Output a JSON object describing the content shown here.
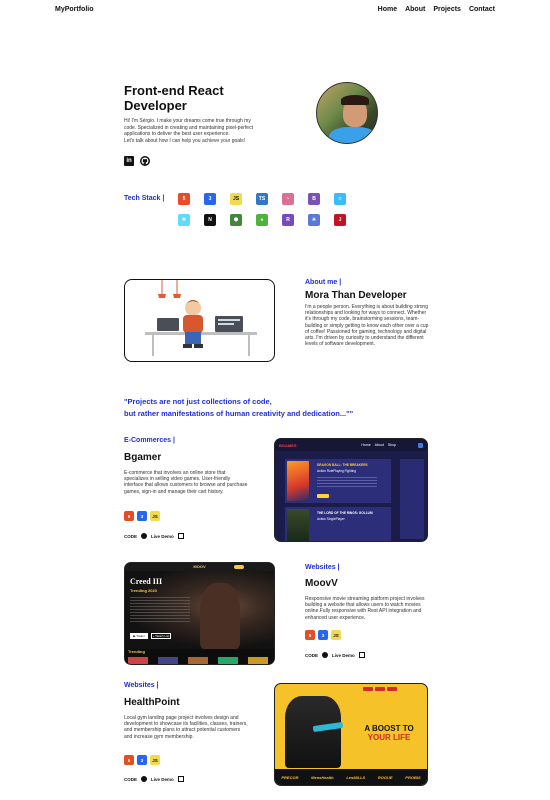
{
  "nav": {
    "logo": "MyPortfolio",
    "links": [
      "Home",
      "About",
      "Projects",
      "Contact"
    ]
  },
  "hero": {
    "title_line1": "Front-end React",
    "title_line2": "Developer",
    "text_line1": "Hi! I'm Sérgio. I make your dreams come true through my",
    "text_line2": "code. Specialized in creating and maintaining pixel-perfect",
    "text_line3": "applications to deliver the best user experience.",
    "text_line4": "Let's talk about how I can help you achieve your goals!",
    "social": {
      "linkedin_icon": "linkedin-icon",
      "github_icon": "github-icon"
    }
  },
  "tech_stack": {
    "label": "Tech Stack |",
    "icons": [
      {
        "name": "html5-icon",
        "glyph": "5",
        "color": "#e44d26"
      },
      {
        "name": "css3-icon",
        "glyph": "3",
        "color": "#2965f1"
      },
      {
        "name": "javascript-icon",
        "glyph": "JS",
        "color": "#f0db4f"
      },
      {
        "name": "typescript-icon",
        "glyph": "TS",
        "color": "#3178c6"
      },
      {
        "name": "styled-components-icon",
        "glyph": "~",
        "color": "#db7093"
      },
      {
        "name": "bootstrap-icon",
        "glyph": "B",
        "color": "#7952b3"
      },
      {
        "name": "tailwind-icon",
        "glyph": "≈",
        "color": "#38bdf8"
      },
      {
        "name": "react-icon",
        "glyph": "⚛",
        "color": "#61dafb"
      },
      {
        "name": "nextjs-icon",
        "glyph": "N",
        "color": "#111111"
      },
      {
        "name": "nodejs-icon",
        "glyph": "⬢",
        "color": "#43853d"
      },
      {
        "name": "mongodb-icon",
        "glyph": "♠",
        "color": "#4db33d"
      },
      {
        "name": "redux-icon",
        "glyph": "R",
        "color": "#764abc"
      },
      {
        "name": "testing-library-icon",
        "glyph": "☀",
        "color": "#5a7ad6"
      },
      {
        "name": "jest-icon",
        "glyph": "J",
        "color": "#c21325"
      }
    ]
  },
  "about": {
    "label": "About me |",
    "title": "Mora Than Developer",
    "text": "I'm a people person. Everything is about building strong relationships and looking for ways to connect. Whether it's through my code, brainstorming sessions, team-building or simply getting to know each other over a cup of coffee! Passioned for gaming, technology and digital arts. I'm driven by curiosity to understand the different levels of software development."
  },
  "quote": {
    "line1": "\"Projects are not just collections of code,",
    "line2": "but rather manifestations of human creativity and dedication...\"\""
  },
  "projects": [
    {
      "category": "E-Commerces |",
      "title": "Bgamer",
      "desc": "E-commerce that involves an online store that specializes in selling video games. User-friendly interface that allows customers to browse and purchase games, sign-in and manage their cart history.",
      "code_label": "CODE",
      "demo_label": "Live Demo",
      "screenshot": {
        "logo": "BGAMES",
        "nav": [
          "Home",
          "About",
          "Shop"
        ],
        "game1": "DRAGON BALL: THE BREAKERS",
        "game1_sub": "Action RolePlaying Fighting",
        "game2": "THE LORD OF THE RINGS: GOLLUM",
        "game2_sub": "Action SinglePlayer",
        "cover1": "DRAGON BALL",
        "cover2": "GOLLUM"
      }
    },
    {
      "category": "Websites |",
      "title": "MoovV",
      "desc": "Responsive movie streaming platform project involves building a website that allows users to watch movies online.Fully responsive with Rest API integration and enhanced user experience.",
      "code_label": "CODE",
      "demo_label": "Live Demo",
      "screenshot": {
        "logo": "MOOV",
        "movie": "Creed III",
        "trending_label": "Trending 2023",
        "trailer_label": "▶ Trailer",
        "watchlist_label": "+ Watch List",
        "row_label": "Trending"
      }
    },
    {
      "category": "Websites |",
      "title": "HealthPoint",
      "desc": "Local gym landing page project involves design and development to showcase its facilities, classes, trainers, and membership plans to attract potential customers and increase gym membership.",
      "code_label": "CODE",
      "demo_label": "Live Demo",
      "screenshot": {
        "headline_line1": "A BOOST TO",
        "headline_line2": "YOUR LIFE",
        "sponsors": [
          "PRECOR",
          "MensHealth",
          "LesMILLS",
          "ROGUE",
          "PROBIS"
        ]
      }
    }
  ]
}
